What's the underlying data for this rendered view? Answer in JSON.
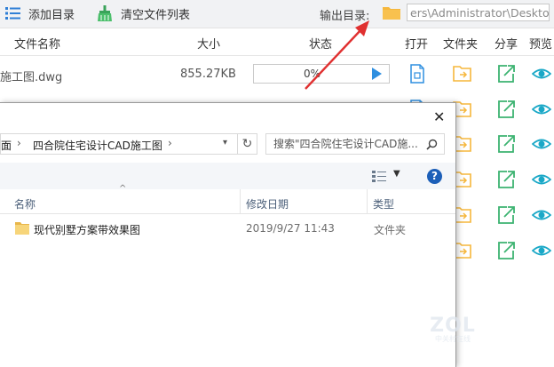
{
  "toolbar": {
    "add_dir_label": "添加目录",
    "clear_list_label": "清空文件列表",
    "output_dir_label": "输出目录:",
    "output_path": "ers\\Administrator\\Desktop"
  },
  "columns": {
    "name": "文件名称",
    "size": "大小",
    "status": "状态",
    "open": "打开",
    "folder": "文件夹",
    "share": "分享",
    "preview": "预览"
  },
  "file_row": {
    "name": "施工图.dwg",
    "size": "855.27KB",
    "progress_text": "0%",
    "progress": 0
  },
  "dialog": {
    "breadcrumb": [
      "面",
      "四合院住宅设计CAD施工图"
    ],
    "search_placeholder": "搜索\"四合院住宅设计CAD施...",
    "columns": {
      "name": "名称",
      "modified": "修改日期",
      "type": "类型"
    },
    "items": [
      {
        "name": "现代别墅方案带效果图",
        "modified": "2019/9/27 11:43",
        "type": "文件夹"
      }
    ]
  },
  "watermark": {
    "brand": "ZOL",
    "sub": "中关村在线"
  },
  "colors": {
    "accent": "#2f8fe0",
    "folder": "#f6b73c",
    "share": "#3cb371",
    "preview": "#1aa8c7",
    "arrow": "#e03030"
  },
  "icons": [
    "list-icon",
    "broom-icon",
    "folder-icon",
    "file-open-icon",
    "folder-open-icon",
    "share-icon",
    "eye-icon",
    "close-icon",
    "refresh-icon",
    "search-icon",
    "view-toggle-icon",
    "help-icon"
  ]
}
